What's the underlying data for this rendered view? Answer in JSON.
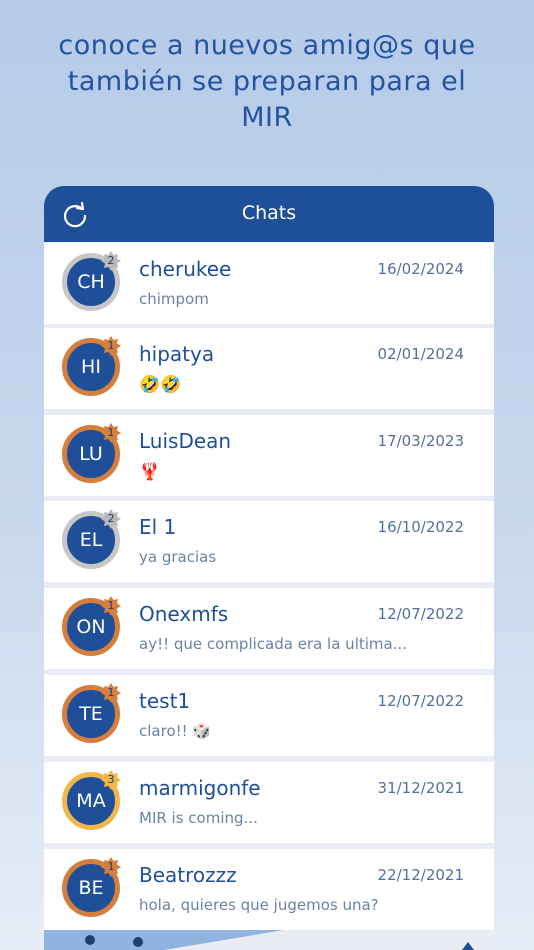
{
  "headline": {
    "line1": "conoce a nuevos amig@s que",
    "line2": "también se preparan para el",
    "line3": "MIR"
  },
  "header": {
    "title": "Chats",
    "refresh_icon": "refresh-icon"
  },
  "chats": [
    {
      "initials": "CH",
      "name": "cherukee",
      "date": "16/02/2024",
      "preview": "chimpom",
      "badge": "2",
      "tier": "silver"
    },
    {
      "initials": "HI",
      "name": "hipatya",
      "date": "02/01/2024",
      "preview": "🤣🤣",
      "badge": "1",
      "tier": "bronze"
    },
    {
      "initials": "LU",
      "name": "LuisDean",
      "date": "17/03/2023",
      "preview": "🦞",
      "badge": "1",
      "tier": "bronze"
    },
    {
      "initials": "EL",
      "name": "El 1",
      "date": "16/10/2022",
      "preview": "ya gracias",
      "badge": "2",
      "tier": "silver"
    },
    {
      "initials": "ON",
      "name": "Onexmfs",
      "date": "12/07/2022",
      "preview": "ay!! que complicada era la ultima...",
      "badge": "1",
      "tier": "bronze"
    },
    {
      "initials": "TE",
      "name": "test1",
      "date": "12/07/2022",
      "preview": "claro!! 🎲",
      "badge": "1",
      "tier": "bronze"
    },
    {
      "initials": "MA",
      "name": "marmigonfe",
      "date": "31/12/2021",
      "preview": "MIR is coming...",
      "badge": "3",
      "tier": "gold"
    },
    {
      "initials": "BE",
      "name": "Beatrozzz",
      "date": "22/12/2021",
      "preview": "hola, quieres que jugemos una?",
      "badge": "1",
      "tier": "bronze"
    }
  ],
  "colors": {
    "brand_blue": "#1e4f99",
    "bronze": "#d57e3e",
    "silver": "#c7c7c7",
    "gold": "#f0b84a"
  }
}
